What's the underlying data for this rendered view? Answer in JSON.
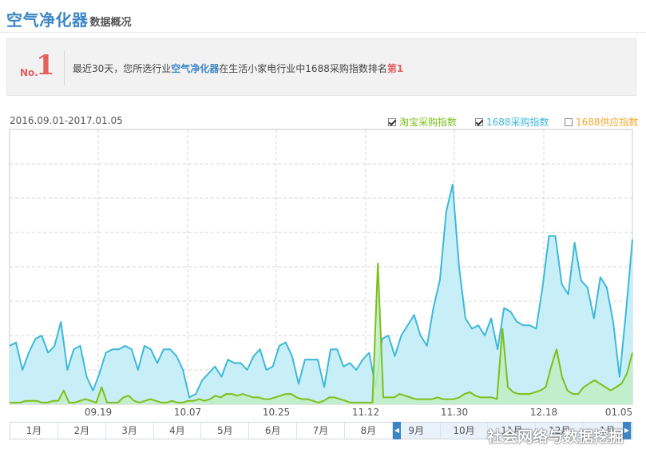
{
  "header": {
    "title": "空气净化器",
    "subtitle": "数据概况"
  },
  "banner": {
    "rank_prefix": "No.",
    "rank_number": "1",
    "text_before": "最近30天，您所选行业",
    "category": "空气净化器",
    "text_middle": "在生活小家电行业中1688采购指数排名",
    "rank_text": "第1"
  },
  "date_range": "2016.09.01-2017.01.05",
  "legend": [
    {
      "label": "淘宝采购指数",
      "checked": true,
      "color": "#7cbf1a"
    },
    {
      "label": "1688采购指数",
      "checked": true,
      "color": "#3cb9d8"
    },
    {
      "label": "1688供应指数",
      "checked": false,
      "color": "#f0a830"
    }
  ],
  "chart_data": {
    "type": "area",
    "x_ticks": [
      "09.19",
      "10.07",
      "10.25",
      "11.12",
      "11.30",
      "12.18",
      "01.05"
    ],
    "y_range": [
      0,
      8
    ],
    "grid": true,
    "series": [
      {
        "name": "1688采购指数",
        "color": "#3cb9d8",
        "values": [
          1.7,
          1.8,
          1.0,
          1.5,
          1.9,
          2.0,
          1.5,
          1.7,
          2.4,
          1.0,
          1.6,
          1.7,
          0.8,
          0.4,
          0.9,
          1.5,
          1.6,
          1.6,
          1.7,
          1.6,
          1.0,
          1.7,
          1.6,
          1.2,
          1.6,
          1.6,
          1.4,
          1.0,
          0.2,
          0.3,
          0.7,
          0.9,
          1.1,
          0.8,
          1.3,
          1.2,
          1.2,
          1.0,
          1.4,
          1.6,
          1.0,
          1.1,
          1.7,
          1.8,
          1.4,
          0.6,
          1.3,
          1.3,
          1.3,
          0.5,
          1.6,
          1.6,
          1.1,
          1.2,
          1.0,
          1.3,
          1.5,
          0.5,
          1.9,
          2.0,
          1.4,
          2.0,
          2.3,
          2.6,
          2.0,
          1.7,
          2.8,
          3.6,
          5.6,
          6.4,
          4.0,
          2.5,
          2.2,
          2.3,
          2.0,
          2.5,
          1.6,
          2.8,
          2.7,
          2.4,
          2.3,
          2.3,
          2.2,
          3.4,
          4.9,
          4.9,
          3.5,
          3.2,
          4.7,
          3.6,
          3.4,
          2.5,
          3.7,
          3.4,
          2.4,
          0.8,
          2.7,
          4.8
        ]
      },
      {
        "name": "淘宝采购指数",
        "color": "#7cbf1a",
        "values": [
          0.05,
          0.05,
          0.05,
          0.1,
          0.1,
          0.1,
          0.05,
          0.05,
          0.1,
          0.1,
          0.4,
          0.05,
          0.05,
          0.1,
          0.15,
          0.1,
          0.05,
          0.5,
          0.05,
          0.05,
          0.05,
          0.2,
          0.25,
          0.1,
          0.05,
          0.1,
          0.15,
          0.1,
          0.05,
          0.05,
          0.1,
          0.05,
          0.05,
          0.1,
          0.1,
          0.15,
          0.1,
          0.15,
          0.25,
          0.2,
          0.3,
          0.3,
          0.25,
          0.3,
          0.25,
          0.2,
          0.2,
          0.15,
          0.15,
          0.2,
          0.25,
          0.3,
          0.3,
          0.2,
          0.15,
          0.15,
          0.1,
          0.05,
          0.1,
          0.2,
          0.2,
          0.15,
          0.1,
          0.05,
          0.05,
          0.05,
          0.05,
          0.05,
          4.1,
          0.2,
          0.2,
          0.2,
          0.3,
          0.25,
          0.2,
          0.15,
          0.15,
          0.15,
          0.15,
          0.2,
          0.15,
          0.15,
          0.15,
          0.2,
          0.3,
          0.35,
          0.25,
          0.2,
          0.2,
          0.2,
          0.15,
          2.2,
          0.5,
          0.35,
          0.3,
          0.3,
          0.3,
          0.35,
          0.4,
          0.5,
          1.1,
          1.6,
          0.8,
          0.4,
          0.3,
          0.3,
          0.5,
          0.6,
          0.7,
          0.6,
          0.5,
          0.4,
          0.5,
          0.6,
          0.9,
          1.5
        ]
      }
    ]
  },
  "timeline": {
    "months": [
      "1月",
      "2月",
      "3月",
      "4月",
      "5月",
      "6月",
      "7月",
      "8月",
      "9月",
      "10月",
      "11月",
      "12月",
      "1月"
    ],
    "selected_from": 8
  },
  "watermark": "社会网络与数据挖掘"
}
